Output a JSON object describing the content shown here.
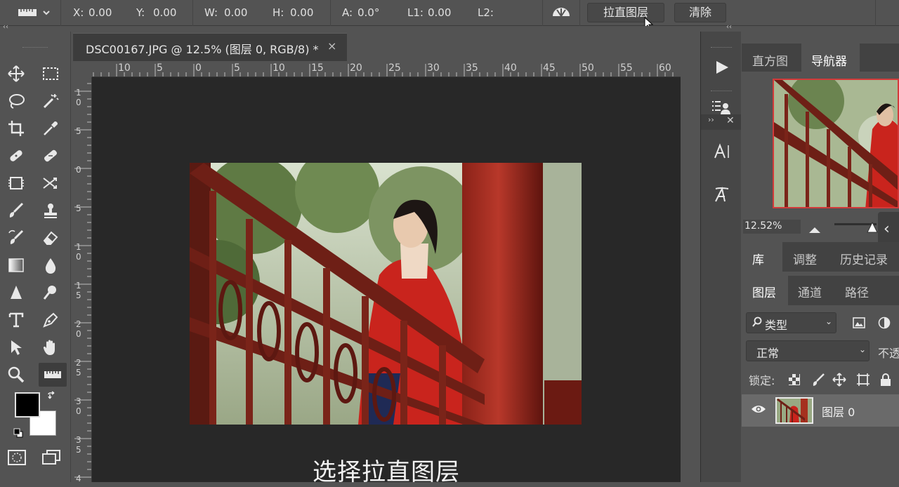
{
  "options_bar": {
    "x_label": "X:",
    "x_value": "0.00",
    "y_label": "Y:",
    "y_value": "0.00",
    "w_label": "W:",
    "w_value": "0.00",
    "h_label": "H:",
    "h_value": "0.00",
    "a_label": "A:",
    "a_value": "0.0°",
    "l1_label": "L1:",
    "l1_value": "0.00",
    "l2_label": "L2:",
    "straighten_button": "拉直图层",
    "clear_button": "清除"
  },
  "document": {
    "tab_title": "DSC00167.JPG @ 12.5% (图层 0, RGB/8) *",
    "close_glyph": "×",
    "h_ruler": [
      "10",
      "5",
      "0",
      "5",
      "10",
      "15",
      "20",
      "25",
      "30",
      "35",
      "40",
      "45",
      "50",
      "55",
      "60"
    ],
    "v_ruler": [
      "1\n0",
      "5",
      "0",
      "5",
      "1\n0",
      "1\n5",
      "2\n0",
      "2\n5",
      "3\n0",
      "3\n5",
      "4"
    ],
    "caption": "选择拉直图层"
  },
  "panels": {
    "nav_tabs": [
      "直方图",
      "导航器"
    ],
    "zoom_value": "12.52%",
    "lib_tabs": [
      "库",
      "调整",
      "历史记录"
    ],
    "layer_tabs": [
      "图层",
      "通道",
      "路径"
    ],
    "filter_kind": "类型",
    "blend_mode": "正常",
    "opacity_label": "不透",
    "lock_label": "锁定:",
    "layer_name": "图层 0"
  },
  "colors": {
    "foreground": "#000000",
    "background": "#ffffff",
    "accent_red": "#c0392b"
  }
}
